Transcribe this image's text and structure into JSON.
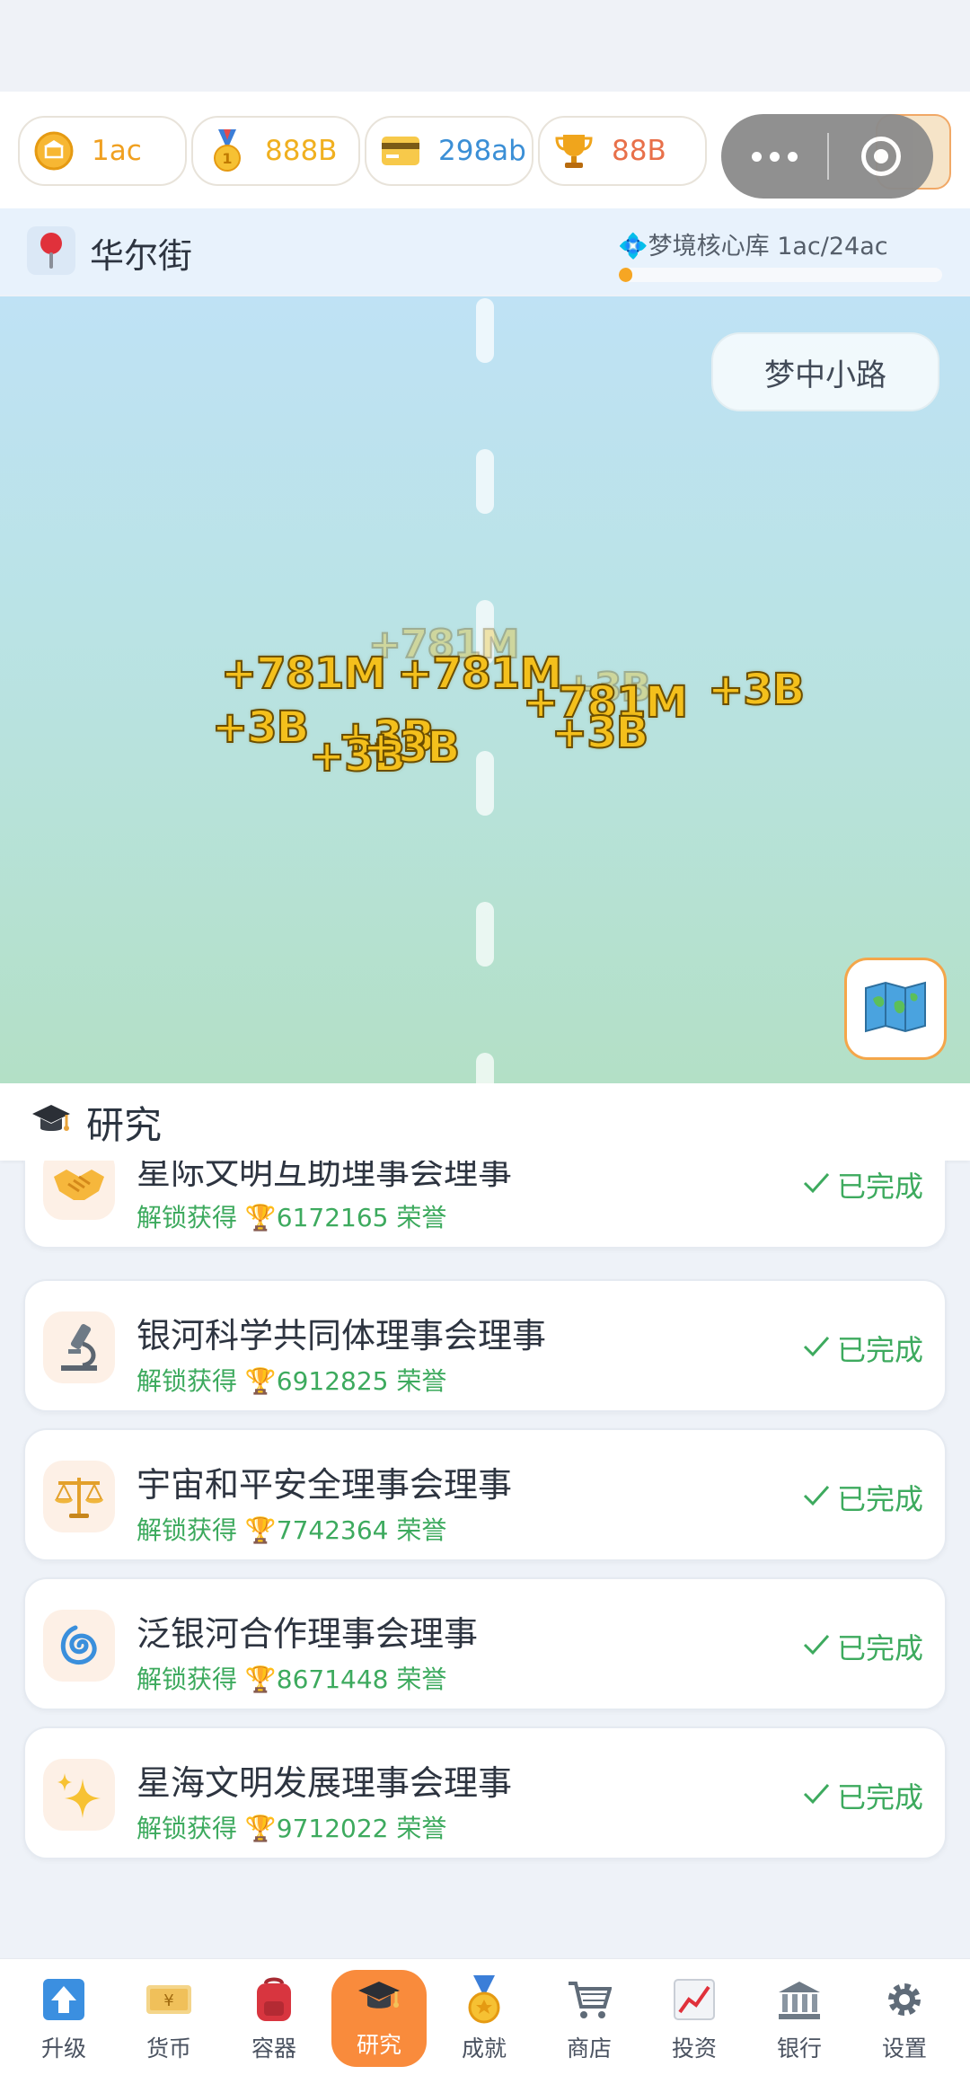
{
  "currencies": [
    {
      "name": "coin",
      "value": "1ac",
      "icon": "coin-icon",
      "color": "#f0a020"
    },
    {
      "name": "medal",
      "value": "888B",
      "icon": "medal-icon",
      "color": "#f0b020"
    },
    {
      "name": "card",
      "value": "298ab",
      "icon": "credit-card-icon",
      "color": "#3b8fd6"
    },
    {
      "name": "trophy",
      "value": "88B",
      "icon": "trophy-icon",
      "color": "#e8704a"
    }
  ],
  "location": {
    "name": "华尔街",
    "vault_label": "💠梦境核心库  1ac/24ac",
    "vault_progress": 0.04167
  },
  "scene": {
    "road_label": "梦中小路",
    "floating_numbers": [
      "+781M",
      "+781M",
      "+781M",
      "+3B",
      "+781M",
      "+3B",
      "+3B",
      "+3B",
      "+3B",
      "+3B",
      "+3B"
    ]
  },
  "research": {
    "title": "研究",
    "items": [
      {
        "name": "星际文明互助理事会理事",
        "reward": "解锁获得 🏆6172165 荣誉",
        "status": "已完成",
        "icon": "handshake-icon"
      },
      {
        "name": "银河科学共同体理事会理事",
        "reward": "解锁获得 🏆6912825 荣誉",
        "status": "已完成",
        "icon": "microscope-icon"
      },
      {
        "name": "宇宙和平安全理事会理事",
        "reward": "解锁获得 🏆7742364 荣誉",
        "status": "已完成",
        "icon": "scales-icon"
      },
      {
        "name": "泛银河合作理事会理事",
        "reward": "解锁获得 🏆8671448 荣誉",
        "status": "已完成",
        "icon": "galaxy-icon"
      },
      {
        "name": "星海文明发展理事会理事",
        "reward": "解锁获得 🏆9712022 荣誉",
        "status": "已完成",
        "icon": "sparkles-icon"
      }
    ]
  },
  "nav": [
    {
      "label": "升级",
      "icon": "upgrade-icon"
    },
    {
      "label": "货币",
      "icon": "currency-icon"
    },
    {
      "label": "容器",
      "icon": "backpack-icon"
    },
    {
      "label": "研究",
      "icon": "graduation-cap-icon",
      "active": true
    },
    {
      "label": "成就",
      "icon": "medal-icon"
    },
    {
      "label": "商店",
      "icon": "cart-icon"
    },
    {
      "label": "投资",
      "icon": "chart-icon"
    },
    {
      "label": "银行",
      "icon": "bank-icon"
    },
    {
      "label": "设置",
      "icon": "gear-icon"
    }
  ]
}
